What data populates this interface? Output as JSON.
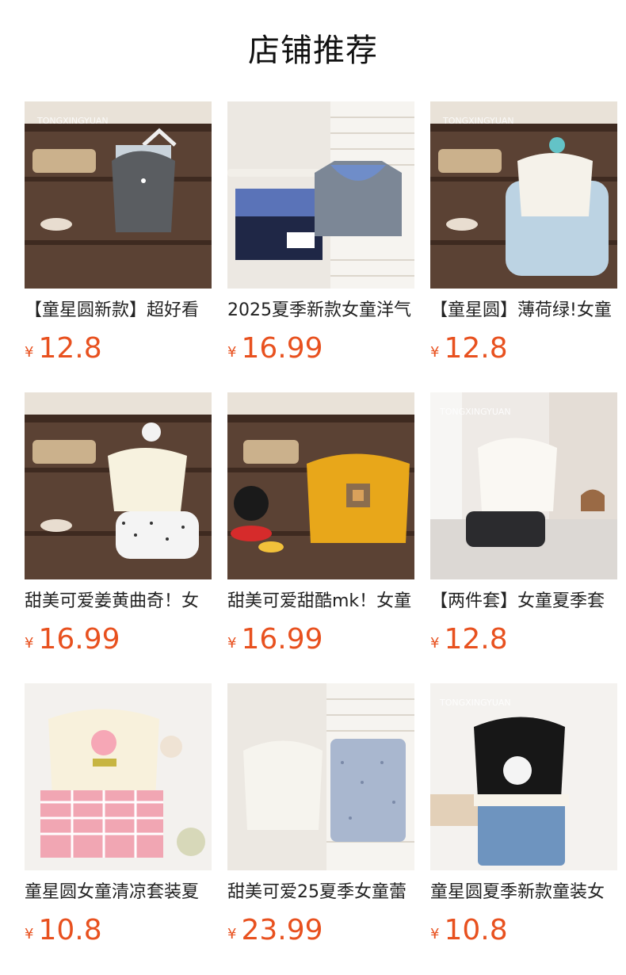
{
  "page": {
    "title": "店铺推荐"
  },
  "accent_color": "#e8511f",
  "products": [
    {
      "name": "【童星圆新款】超好看",
      "currency": "¥",
      "price": "12.8",
      "brand_watermark": "TONGXINGYUAN",
      "image": "grey-ruffle-tank-striped-shorts"
    },
    {
      "name": "2025夏季新款女童洋气",
      "currency": "¥",
      "price": "16.99",
      "image": "navy-plaid-skirt-and-top"
    },
    {
      "name": "【童星圆】薄荷绿!女童",
      "currency": "¥",
      "price": "12.8",
      "brand_watermark": "TONGXINGYUAN",
      "image": "white-tee-mint-bloomers"
    },
    {
      "name": "甜美可爱姜黄曲奇！女",
      "currency": "¥",
      "price": "16.99",
      "image": "cream-tee-dot-bloomers"
    },
    {
      "name": "甜美可爱甜酷mk！女童",
      "currency": "¥",
      "price": "16.99",
      "image": "yellow-pixel-tee-mickey"
    },
    {
      "name": "【两件套】女童夏季套",
      "currency": "¥",
      "price": "12.8",
      "brand_watermark": "TONGXINGYUAN",
      "image": "white-blouse-black-skirt"
    },
    {
      "name": "童星圆女童清凉套装夏",
      "currency": "¥",
      "price": "10.8",
      "image": "bunny-top-pink-gingham"
    },
    {
      "name": "甜美可爱25夏季女童蕾",
      "currency": "¥",
      "price": "23.99",
      "image": "lace-vest-floral-shorts"
    },
    {
      "name": "童星圆夏季新款童装女",
      "currency": "¥",
      "price": "10.8",
      "brand_watermark": "TONGXINGYUAN",
      "image": "black-kitty-vest-denim-shorts"
    }
  ]
}
